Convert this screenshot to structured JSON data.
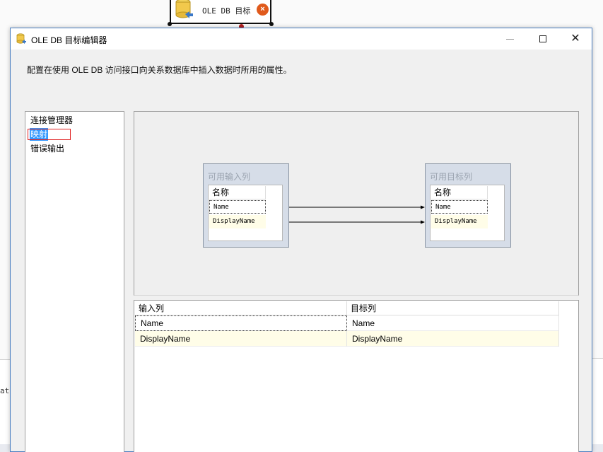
{
  "background_task": {
    "label": "OLE DB 目标",
    "error_glyph": "×",
    "icon": "database-destination-icon",
    "edge_text": "at"
  },
  "dialog": {
    "title": "OLE DB 目标编辑器",
    "minimize_glyph": "—",
    "close_glyph": "✕",
    "description": "配置在使用 OLE DB 访问接口向关系数据库中插入数据时所用的属性。",
    "nav": {
      "items": [
        {
          "label": "连接管理器"
        },
        {
          "label": "映射",
          "selected": true
        },
        {
          "label": "错误输出"
        }
      ]
    },
    "mapping": {
      "input_box": {
        "title": "可用输入列",
        "header": "名称",
        "rows": [
          "Name",
          "DisplayName"
        ]
      },
      "output_box": {
        "title": "可用目标列",
        "header": "名称",
        "rows": [
          "Name",
          "DisplayName"
        ]
      }
    },
    "grid": {
      "headers": [
        "输入列",
        "目标列"
      ],
      "rows": [
        [
          "Name",
          "Name"
        ],
        [
          "DisplayName",
          "DisplayName"
        ]
      ]
    }
  },
  "colors": {
    "accent_border": "#4a7fc1",
    "selection": "#3399ff",
    "error": "#e05a1c",
    "highlight_row": "#fffde8"
  }
}
